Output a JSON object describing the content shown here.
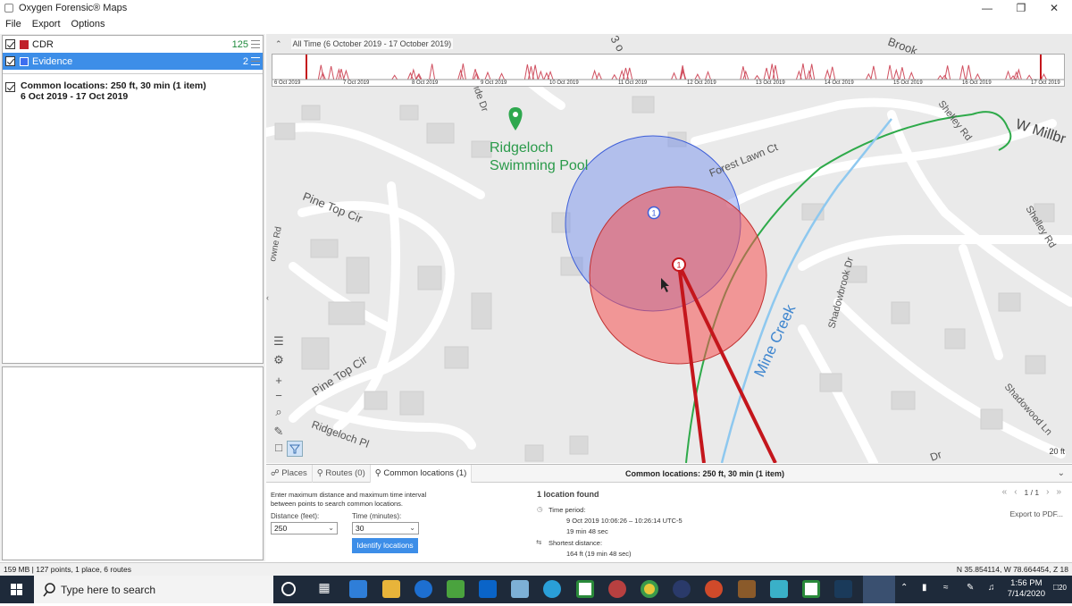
{
  "window": {
    "title": "Oxygen Forensic® Maps"
  },
  "menu": [
    "File",
    "Export",
    "Options"
  ],
  "layers": [
    {
      "label": "CDR",
      "count": "125",
      "color": "#c0202a",
      "selected": false
    },
    {
      "label": "Evidence",
      "count": "2",
      "color": "#3d6ef0",
      "selected": true
    }
  ],
  "common_location_entry": {
    "line1": "Common locations: 250 ft, 30 min (1 item)",
    "line2": "6 Oct 2019 - 17 Oct 2019"
  },
  "timeline": {
    "range_label": "All Time (6 October 2019 - 17 October 2019)",
    "dates": [
      "6 Oct 2019",
      "7 Oct 2019",
      "8 Oct 2019",
      "9 Oct 2019",
      "10 Oct 2019",
      "11 Oct 2019",
      "12 Oct 2019",
      "13 Oct 2019",
      "14 Oct 2019",
      "15 Oct 2019",
      "16 Oct 2019",
      "17 Oct 2019"
    ]
  },
  "map": {
    "poi": {
      "name_line1": "Ridgeloch",
      "name_line2": "Swimming Pool"
    },
    "streets": [
      "Pine Top Cir",
      "Pine Top Cir",
      "Ridgeloch Pl",
      "Forest Lawn Ct",
      "Shelley Rd",
      "Shelley Rd",
      "W Millbr",
      "Shadowbrook Dr",
      "Shadowood Ln",
      "Mine Creek",
      "owne Rd",
      "ide Dr",
      "Brook",
      "3 o",
      "Dr"
    ],
    "markers": [
      {
        "label": "1",
        "layer": "Evidence"
      },
      {
        "label": "1",
        "layer": "CDR"
      }
    ],
    "scale": "20 ft"
  },
  "bottom_tabs": [
    {
      "label": "Places",
      "active": false
    },
    {
      "label": "Routes (0)",
      "active": false
    },
    {
      "label": "Common locations (1)",
      "active": true
    }
  ],
  "bottom_panel": {
    "title": "Common locations: 250 ft, 30 min (1 item)",
    "description": "Enter maximum distance and maximum time interval between points to search common locations.",
    "distance_label": "Distance (feet):",
    "distance_value": "250",
    "time_label": "Time (minutes):",
    "time_value": "30",
    "identify_button": "Identify locations",
    "found": "1 location found",
    "time_period_label": "Time period:",
    "time_period_value": "9 Oct 2019  10:06:26 – 10:26:14 UTC-5",
    "time_period_duration": "19 min 48 sec",
    "shortest_label": "Shortest distance:",
    "shortest_value": "164 ft (19 min 48 sec)",
    "page": "1 / 1",
    "export": "Export to PDF..."
  },
  "status": {
    "left": "159 MB | 127 points, 1 place, 6 routes",
    "right": "N 35.854114, W 78.664454, Z 18"
  },
  "taskbar": {
    "search_placeholder": "Type here to search",
    "time": "1:56 PM",
    "date": "7/14/2020",
    "notifications": "20"
  }
}
